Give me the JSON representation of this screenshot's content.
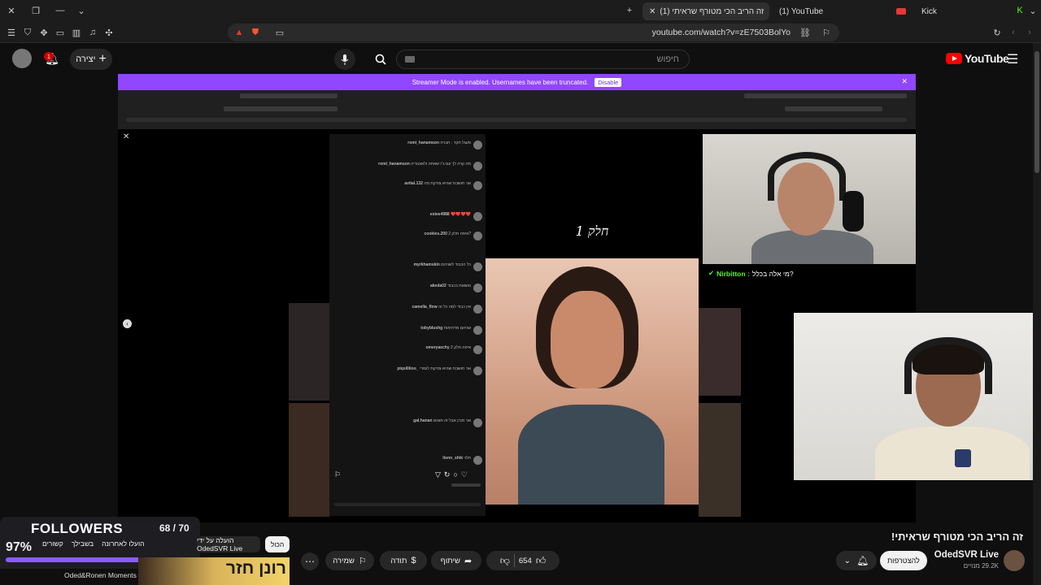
{
  "browser": {
    "tabs": [
      {
        "label": "(1) זה הריב הכי מטורף שראיתי",
        "active": true
      },
      {
        "label": "(1) YouTube",
        "active": false
      },
      {
        "label": "Kick",
        "active": false
      }
    ],
    "url": "youtube.com/watch?v=zE7503BolYo"
  },
  "header": {
    "create_label": "יצירה",
    "notif_count": "1",
    "search_placeholder": "חיפוש",
    "logo_text": "YouTube"
  },
  "video": {
    "streamer_bar_text": "Streamer Mode is enabled. Usernames have been truncated.",
    "disable_label": "Disable",
    "reel_caption": "חלק 1",
    "chat": {
      "name": "Nirbitton",
      "message": "מי אלה בכלל?"
    },
    "ig_comments": [
      {
        "user": "romi_hanamson",
        "text": "מעגל חקר · חברה"
      },
      {
        "user": "romi_hanamson",
        "text": "מה קרה לך עם ג׳ו שאתה ולאוטוריה"
      },
      {
        "user": "avital.132",
        "text": "אני חושבת שהיא צודקת מה"
      },
      {
        "user": "estee4988",
        "text": "❤️❤️❤️❤️"
      },
      {
        "user": "cookies.200",
        "text": "איפה חלק 2?"
      },
      {
        "user": "myrkhamskin",
        "text": "כל הכבוד לשניהם"
      },
      {
        "user": "akeda02",
        "text": "נושאות בכבוד"
      },
      {
        "user": "camella_flow",
        "text": "אין כבוד למה כל זה"
      },
      {
        "user": "tobyblushg",
        "text": "שניהם מדהימות"
      },
      {
        "user": "omeryaechy",
        "text": "איפה חלק 2"
      },
      {
        "user": "gal.hanan",
        "text": "אני מבין אבל זה מוגזם"
      },
      {
        "user": "lionn_shik",
        "text": "תלוי"
      }
    ]
  },
  "followers_widget": {
    "title": "FOLLOWERS",
    "count": "68 / 70",
    "percent": "97%",
    "progress": 0.97
  },
  "watch": {
    "title": "זה הריב הכי מטורף שראיתי!",
    "channel_name": "OdedSVR Live",
    "subscribers": "29.2K מנויים",
    "join_label": "להצטרפות",
    "likes": "654",
    "share_label": "שיתוף",
    "thanks_label": "תודה",
    "save_label": "שמירה",
    "chips": {
      "all": "הכול",
      "uploaded_by": "הועלה על ידי OdedSVR Live",
      "related": "קשורים",
      "for_you": "בשבילך",
      "recently": "הועלו לאחרונה"
    },
    "recommended": {
      "thumb_text": "רונן חזר",
      "channel": "Oded&Ronen Moments"
    }
  }
}
